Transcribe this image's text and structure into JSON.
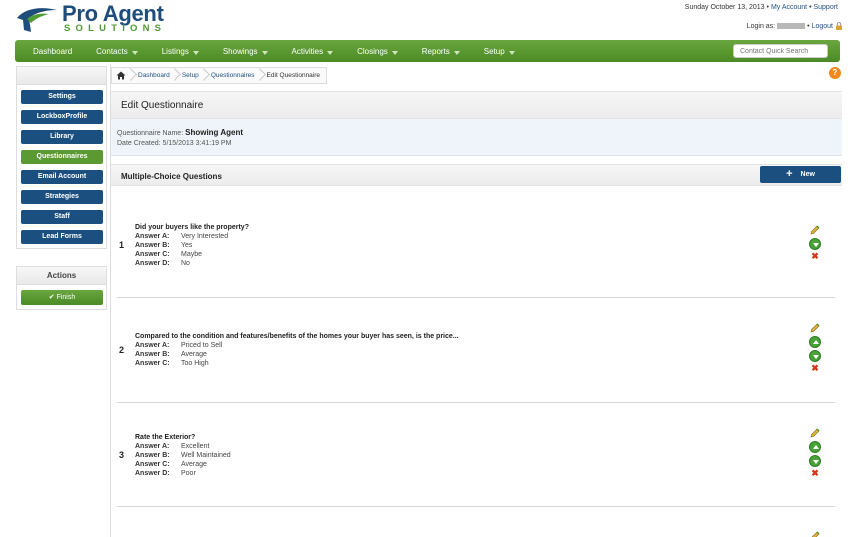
{
  "header": {
    "logo_main": "Pro Agent",
    "logo_sub": "SOLUTIONS",
    "date": "Sunday October 13, 2013 •",
    "my_account": "My Account",
    "support": "Support",
    "login_label": "Login as:",
    "logout": "Logout"
  },
  "nav": {
    "items": [
      "Dashboard",
      "Contacts",
      "Listings",
      "Showings",
      "Activities",
      "Closings",
      "Reports",
      "Setup"
    ],
    "quick_search_placeholder": "Contact Quick Search"
  },
  "sidebar": {
    "items": [
      "Settings",
      "LockboxProfile",
      "Library",
      "Questionnaires",
      "Email Account",
      "Strategies",
      "Staff",
      "Lead Forms"
    ],
    "active": "Questionnaires",
    "actions_title": "Actions",
    "finish_label": "Finish"
  },
  "breadcrumb": [
    "Dashboard",
    "Setup",
    "Questionnaires",
    "Edit Questionnaire"
  ],
  "page": {
    "title": "Edit Questionnaire",
    "name_label": "Questionnaire Name:",
    "name_value": "Showing Agent",
    "date_label": "Date Created:",
    "date_value": "5/15/2013 3:41:19 PM",
    "section_title": "Multiple-Choice Questions",
    "new_label": "New"
  },
  "questions": [
    {
      "number": "1",
      "text": "Did your buyers like the property?",
      "answers": [
        {
          "label": "Answer A:",
          "value": "Very Interested"
        },
        {
          "label": "Answer B:",
          "value": "Yes"
        },
        {
          "label": "Answer C:",
          "value": "Maybe"
        },
        {
          "label": "Answer D:",
          "value": "No"
        }
      ]
    },
    {
      "number": "2",
      "text": "Compared to the condition and features/benefits of the homes your buyer has seen, is the price...",
      "answers": [
        {
          "label": "Answer A:",
          "value": "Priced to Sell"
        },
        {
          "label": "Answer B:",
          "value": "Average"
        },
        {
          "label": "Answer C:",
          "value": "Too High"
        }
      ]
    },
    {
      "number": "3",
      "text": "Rate the Exterior?",
      "answers": [
        {
          "label": "Answer A:",
          "value": "Excellent"
        },
        {
          "label": "Answer B:",
          "value": "Well Maintained"
        },
        {
          "label": "Answer C:",
          "value": "Average"
        },
        {
          "label": "Answer D:",
          "value": "Poor"
        }
      ]
    }
  ],
  "colors": {
    "nav_green": "#5b9a33",
    "brand_blue": "#1b4f80",
    "logo_green": "#4f9a34"
  }
}
